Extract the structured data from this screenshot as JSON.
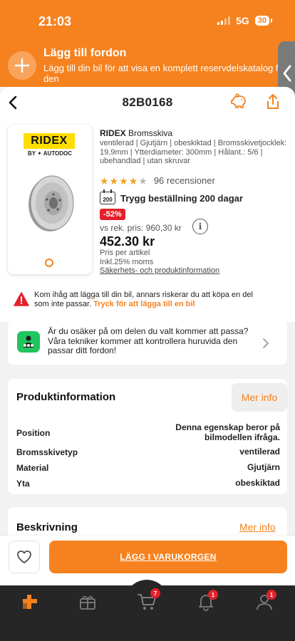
{
  "status": {
    "time": "21:03",
    "network": "5G",
    "battery": "30"
  },
  "vehicle_banner": {
    "title": "Lägg till fordon",
    "subtitle": "Lägg till din bil för att visa en komplett reservdelskatalog för den"
  },
  "header": {
    "sku": "82B0168"
  },
  "product": {
    "brand_logo": "RIDEX",
    "logo_sub": "BY ✦ AUTODOC",
    "brand": "RIDEX",
    "name": "Bromsskiva",
    "description": "ventilerad | Gjutjärn | obeskiktad | Bromsskivetjocklek: 19,9mm | Ytterdiameter: 300mm | Hålant.: 5/6 | ubehandlad | utan skruvar",
    "rating": 4,
    "rating_max": 5,
    "reviews": "96 recensioner",
    "guarantee_icon": "200",
    "guarantee": "Trygg beställning 200 dagar",
    "discount": "-52%",
    "rrp": "vs rek. pris: 960,30 kr",
    "price": "452.30 kr",
    "price_per": "Pris per artikel",
    "vat": "Inkl.25% moms",
    "safety_link": "Säkerhets- och produktinformation"
  },
  "warning": {
    "text": "Kom ihåg att lägga till din bil, annars riskerar du att köpa en del som inte passar. ",
    "link": "Tryck för att lägga till en bil"
  },
  "check": {
    "text": "Är du osäker på om delen du valt kommer att passa? Våra tekniker kommer att kontrollera huruvida den passar ditt fordon!"
  },
  "product_info": {
    "title": "Produktinformation",
    "more": "Mer info",
    "rows": [
      {
        "label": "Position",
        "value": "Denna egenskap beror på bilmodellen ifråga."
      },
      {
        "label": "Bromsskivetyp",
        "value": "ventilerad"
      },
      {
        "label": "Material",
        "value": "Gjutjärn"
      },
      {
        "label": "Yta",
        "value": "obeskiktad"
      }
    ]
  },
  "description": {
    "title": "Beskrivning",
    "more": "Mer info"
  },
  "cart": {
    "add_label": "LÄGG I VARUKORGEN"
  },
  "tabbar": {
    "cart_count": "7",
    "notif_count": "1",
    "profile_count": "1"
  },
  "colors": {
    "accent": "#f5821f",
    "discount": "#e3202a",
    "check": "#21c55e",
    "tabbar": "#262626"
  }
}
